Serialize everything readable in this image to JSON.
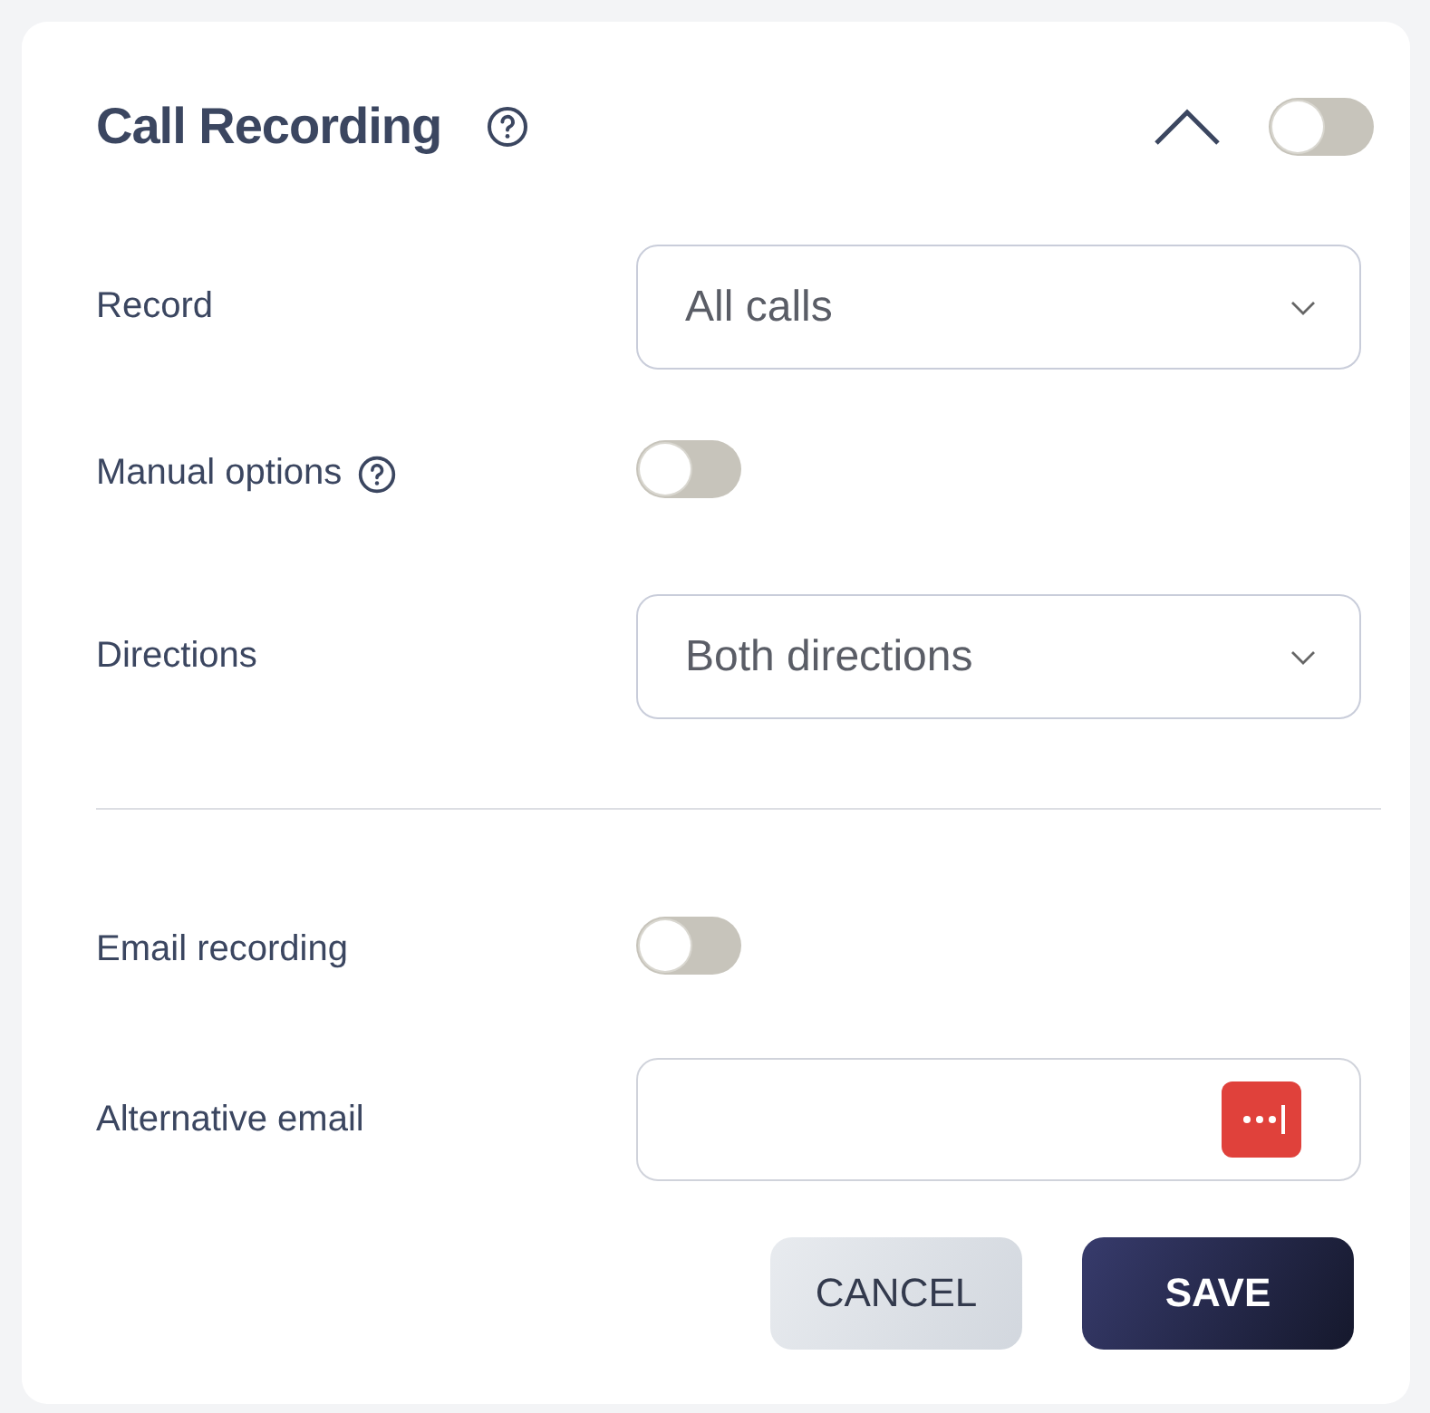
{
  "panel": {
    "title": "Call Recording",
    "help": true,
    "expanded": true,
    "enabled": false
  },
  "sections": [
    {
      "rows": [
        {
          "label": "Record",
          "kind": "select",
          "help": false,
          "value": "All calls"
        },
        {
          "label": "Manual options",
          "kind": "toggle",
          "help": true,
          "on": false
        },
        {
          "label": "Directions",
          "kind": "select",
          "help": false,
          "value": "Both directions"
        }
      ]
    },
    {
      "rows": [
        {
          "label": "Email recording",
          "kind": "toggle",
          "help": false,
          "on": false
        },
        {
          "label": "Alternative email",
          "kind": "input",
          "help": false
        }
      ]
    }
  ],
  "buttons": [
    {
      "label": "CANCEL",
      "kind": "secondary"
    },
    {
      "label": "SAVE",
      "kind": "primary"
    }
  ]
}
